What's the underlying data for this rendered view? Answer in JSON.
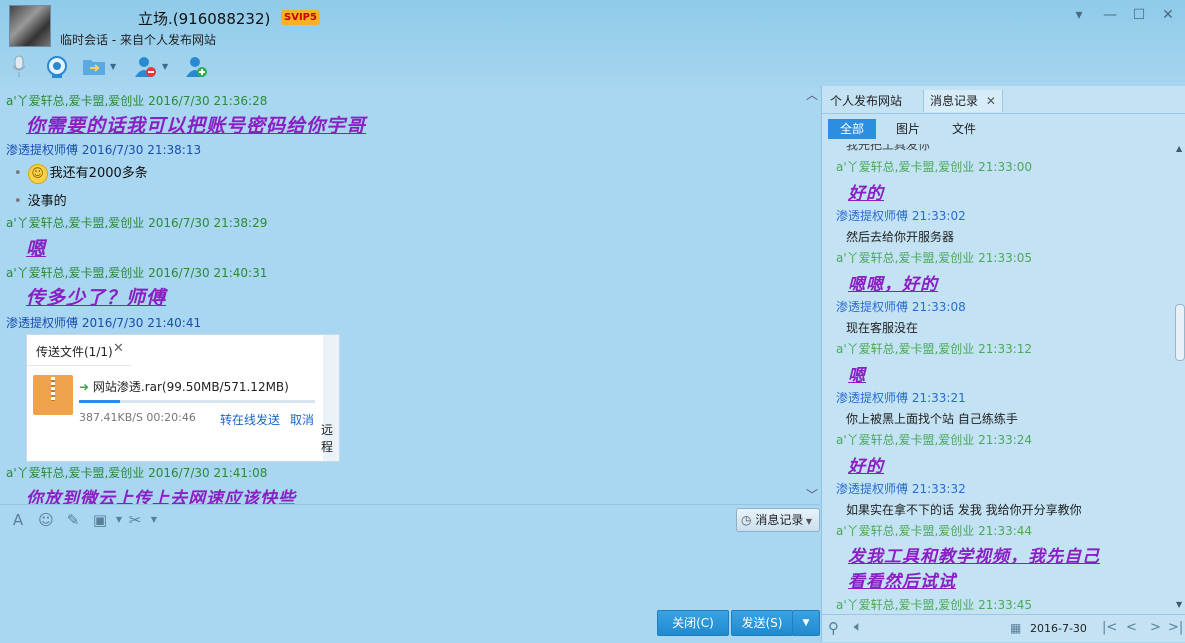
{
  "header": {
    "title": "立场.(916088232)",
    "vip": "SVIP5",
    "subtitle": "临时会话 - 来自个人发布网站"
  },
  "window_controls": {
    "dropdown": "▾",
    "minimize": "—",
    "maximize": "☐",
    "close": "✕"
  },
  "toolbar": {
    "icons": [
      "microphone-icon",
      "video-icon",
      "folder-transfer-icon",
      "remove-user-icon",
      "add-user-icon"
    ]
  },
  "chat": {
    "messages": [
      {
        "sender": "a'丫爱轩总,爱卡盟,爱创业",
        "time": "2016/7/30 21:36:28",
        "text": "你需要的话我可以把账号密码给你宇哥",
        "style": "art"
      },
      {
        "sender": "渗透提权师傅",
        "time": "2016/7/30 21:38:13",
        "text": "我还有2000多条",
        "style": "plain"
      },
      {
        "text": "没事的",
        "style": "plain"
      },
      {
        "sender": "a'丫爱轩总,爱卡盟,爱创业",
        "time": "2016/7/30 21:38:29",
        "text": "嗯",
        "style": "art"
      },
      {
        "sender": "a'丫爱轩总,爱卡盟,爱创业",
        "time": "2016/7/30 21:40:31",
        "text": "传多少了？师傅",
        "style": "art"
      },
      {
        "sender": "渗透提权师傅",
        "time": "2016/7/30 21:40:41"
      },
      {
        "sender": "a'丫爱轩总,爱卡盟,爱创业",
        "time": "2016/7/30 21:41:08",
        "text": "你放到微云上传上去网速应该快些",
        "style": "art"
      }
    ],
    "transfer": {
      "tab_label": "传送文件(1/1)",
      "file": "网站渗透.rar(99.50MB/571.12MB)",
      "speed": "387.41KB/S 00:20:46",
      "send_online": "转在线发送",
      "cancel": "取消",
      "progress": 0.174,
      "side_text": "远程"
    }
  },
  "input_bar": {
    "history_button": "消息记录"
  },
  "actions": {
    "close": "关闭(C)",
    "send": "发送(S)"
  },
  "right_panel": {
    "tabs": [
      "个人发布网站",
      "消息记录"
    ],
    "filters": [
      "全部",
      "图片",
      "文件"
    ],
    "top_partial": "我先把工具发你",
    "records": [
      {
        "sender": "a'丫爱轩总,爱卡盟,爱创业",
        "time": "21:33:00",
        "text": "好的",
        "style": "art"
      },
      {
        "sender": "渗透提权师傅",
        "time": "21:33:02",
        "text": "然后去给你开服务器",
        "style": "plain"
      },
      {
        "sender": "a'丫爱轩总,爱卡盟,爱创业",
        "time": "21:33:05",
        "text": "嗯嗯，好的",
        "style": "art"
      },
      {
        "sender": "渗透提权师傅",
        "time": "21:33:08",
        "text": "现在客服没在",
        "style": "plain"
      },
      {
        "sender": "a'丫爱轩总,爱卡盟,爱创业",
        "time": "21:33:12",
        "text": "嗯",
        "style": "art"
      },
      {
        "sender": "渗透提权师傅",
        "time": "21:33:21",
        "text": "你上被黑上面找个站 自己练练手",
        "style": "plain"
      },
      {
        "sender": "a'丫爱轩总,爱卡盟,爱创业",
        "time": "21:33:24",
        "text": "好的",
        "style": "art"
      },
      {
        "sender": "渗透提权师傅",
        "time": "21:33:32",
        "text": "如果实在拿不下的话  发我 我给你开分享教你",
        "style": "plain"
      },
      {
        "sender": "a'丫爱轩总,爱卡盟,爱创业",
        "time": "21:33:44",
        "text": "发我工具和教学视频，我先自己",
        "text2": "看看然后试试",
        "style": "art2"
      },
      {
        "sender": "a'丫爱轩总,爱卡盟,爱创业",
        "time": "21:33:45",
        "style": "head"
      }
    ],
    "date": "2016-7-30"
  }
}
